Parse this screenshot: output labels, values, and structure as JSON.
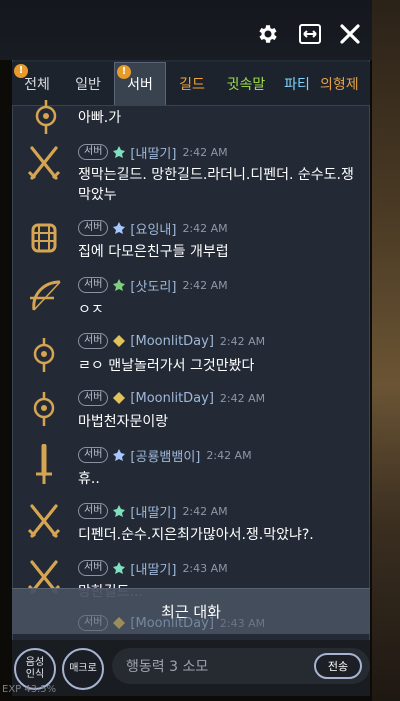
{
  "colors": {
    "accent": "#e89a2a",
    "panel": "#232a36",
    "tab_guild": "#f0a43a",
    "tab_whisper": "#9fdc4a",
    "tab_party": "#7fd3ff",
    "tab_other": "#e4a24a",
    "name": "#9fb8d8",
    "time": "#8e97a6"
  },
  "header": {
    "settings_icon": "gear-icon",
    "resize_icon": "resize-icon",
    "close_icon": "close-icon"
  },
  "tabs": [
    {
      "label": "전체",
      "badge": "!"
    },
    {
      "label": "일반"
    },
    {
      "label": "서버",
      "badge": "!",
      "active": true
    },
    {
      "label": "길드"
    },
    {
      "label": "귓속말"
    },
    {
      "label": "파티"
    },
    {
      "label": "의형제"
    }
  ],
  "messages": [
    {
      "chip": "",
      "name": "",
      "time": "",
      "text": "아빠.가"
    },
    {
      "chip": "서버",
      "name": "[내딸기]",
      "time": "2:42 AM",
      "text": "쟁막는길드. 망한길드.라더니.디펜더. 순수도.쟁막았누"
    },
    {
      "chip": "서버",
      "name": "[요잉내]",
      "time": "2:42 AM",
      "text": "집에 다모은친구들 개부럽"
    },
    {
      "chip": "서버",
      "name": "[삿도리]",
      "time": "2:42 AM",
      "text": "ㅇㅈ"
    },
    {
      "chip": "서버",
      "name": "[MoonlitDay]",
      "time": "2:42 AM",
      "text": "ㄹㅇ 맨날놀러가서 그것만봤다"
    },
    {
      "chip": "서버",
      "name": "[MoonlitDay]",
      "time": "2:42 AM",
      "text": "마법천자문이랑"
    },
    {
      "chip": "서버",
      "name": "[공룡뱀뱀이]",
      "time": "2:42 AM",
      "text": "휴.."
    },
    {
      "chip": "서버",
      "name": "[내딸기]",
      "time": "2:42 AM",
      "text": "디펜더.순수.지은최가많아서.쟁.막았냐?."
    },
    {
      "chip": "서버",
      "name": "[내딸기]",
      "time": "2:43 AM",
      "text": "망한길드..."
    },
    {
      "chip": "서버",
      "name": "[MoonlitDay]",
      "time": "2:43 AM",
      "text": ""
    }
  ],
  "recent_button": "최근 대화",
  "bottom": {
    "voice_label_1": "음성",
    "voice_label_2": "인식",
    "macro_label": "매크로",
    "input_placeholder": "행동력 3 소모",
    "send_label": "전송",
    "exp_text": "EXP 43.5%"
  }
}
